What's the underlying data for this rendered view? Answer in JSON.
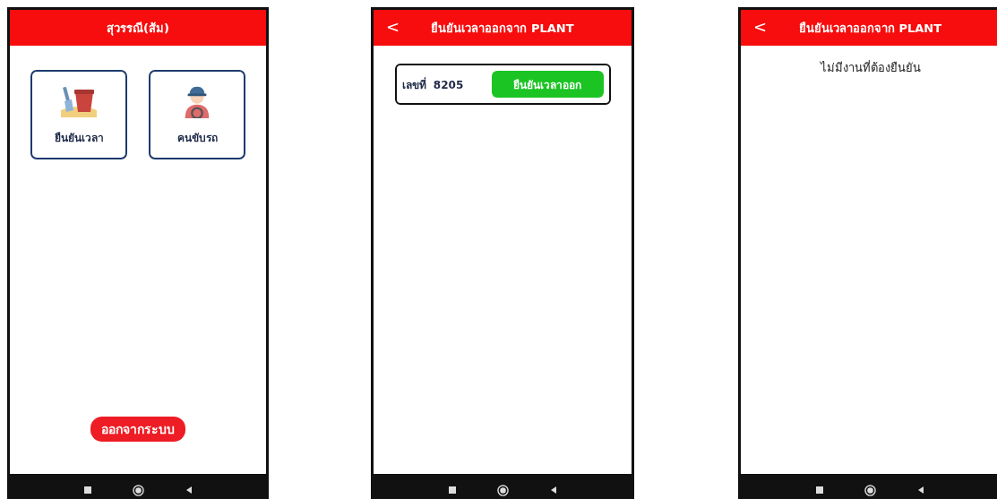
{
  "screens": [
    {
      "kind": "menu",
      "title": "สุวรรณี(ส้ม)",
      "menu": [
        {
          "label": "ยืนยันเวลา",
          "kind": "bucket"
        },
        {
          "label": "คนขับรถ",
          "kind": "driver"
        }
      ],
      "logout": "ออกจากระบบ"
    },
    {
      "kind": "jobs",
      "title": "ยืนยันเวลาออกจาก PLANT",
      "back_icon": "<",
      "jobs": [
        {
          "number": "เลขที่  8205",
          "action": "ยืนยันเวลาออก"
        }
      ]
    },
    {
      "kind": "empty",
      "title": "ยืนยันเวลาออกจาก PLANT",
      "back_icon": "<",
      "message": "ไม่มีงานที่ต้องยืนยัน"
    }
  ]
}
